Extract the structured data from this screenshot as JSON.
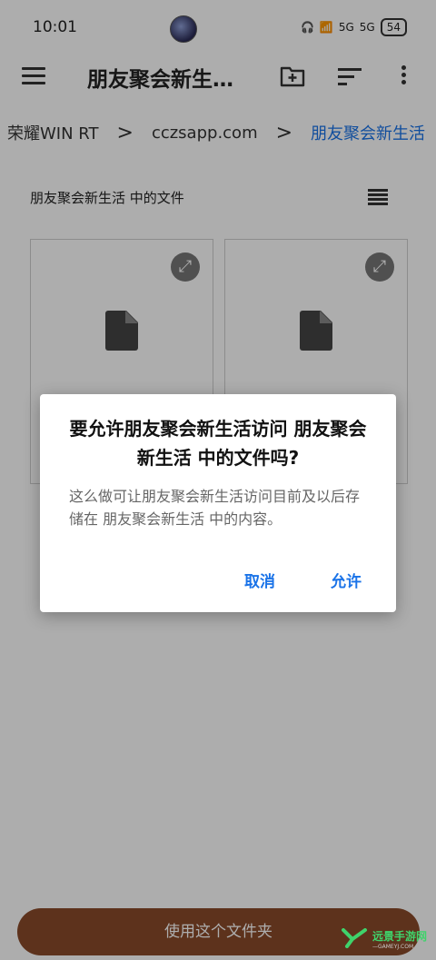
{
  "status_bar": {
    "time": "10:01",
    "network_1": "5G",
    "network_2": "5G",
    "battery": "54"
  },
  "app_bar": {
    "title": "朋友聚会新生…",
    "menu_icon": "hamburger-menu-icon",
    "new_folder_icon": "create-new-folder-icon",
    "sort_icon": "sort-icon",
    "more_icon": "more-vert-icon"
  },
  "breadcrumb": {
    "items": [
      "荣耀WIN RT",
      "cczsapp.com",
      "朋友聚会新生活"
    ],
    "separator": ">"
  },
  "section": {
    "title": "朋友聚会新生活 中的文件",
    "view_icon": "list-view-icon"
  },
  "files": {
    "file_icon": "document-icon",
    "expand_icon": "expand-icon",
    "count_visible": 2
  },
  "bottom_button": {
    "label": "使用这个文件夹"
  },
  "watermark": {
    "text": "远景手游网",
    "sub": "—GAMEYJ.COM"
  },
  "dialog": {
    "title": "要允许朋友聚会新生活访问 朋友聚会新生活 中的文件吗?",
    "message": "这么做可让朋友聚会新生活访问目前及以后存储在 朋友聚会新生活 中的内容。",
    "cancel_label": "取消",
    "allow_label": "允许"
  },
  "colors": {
    "accent": "#1a73e8",
    "button_bg": "#8a4a2a",
    "scrim": "rgba(0,0,0,0.32)"
  }
}
